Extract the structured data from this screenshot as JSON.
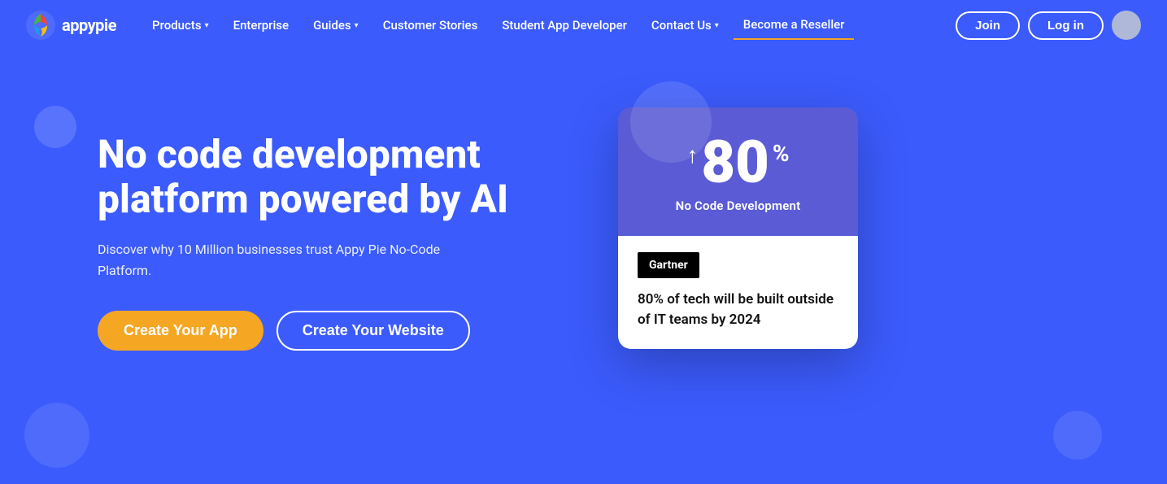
{
  "logo": {
    "text": "appypie",
    "alt": "Appy Pie Logo"
  },
  "nav": {
    "items": [
      {
        "label": "Products",
        "hasDropdown": true,
        "active": false
      },
      {
        "label": "Enterprise",
        "hasDropdown": false,
        "active": false
      },
      {
        "label": "Guides",
        "hasDropdown": true,
        "active": false
      },
      {
        "label": "Customer Stories",
        "hasDropdown": false,
        "active": false
      },
      {
        "label": "Student App Developer",
        "hasDropdown": false,
        "active": false
      },
      {
        "label": "Contact Us",
        "hasDropdown": true,
        "active": false
      },
      {
        "label": "Become a Reseller",
        "hasDropdown": false,
        "active": true
      }
    ],
    "join_label": "Join",
    "login_label": "Log in"
  },
  "hero": {
    "title": "No code development platform powered by AI",
    "subtitle": "Discover why 10 Million businesses trust Appy Pie No-Code Platform.",
    "cta_primary": "Create Your App",
    "cta_secondary": "Create Your Website"
  },
  "stats_card": {
    "arrow": "↑",
    "number": "80",
    "percent": "%",
    "label": "No Code Development",
    "badge": "Gartner",
    "description": "80% of tech will be built outside of IT teams by 2024"
  },
  "colors": {
    "bg_blue": "#3b5bfc",
    "card_purple": "#5b5bd6",
    "btn_yellow": "#f5a623"
  }
}
